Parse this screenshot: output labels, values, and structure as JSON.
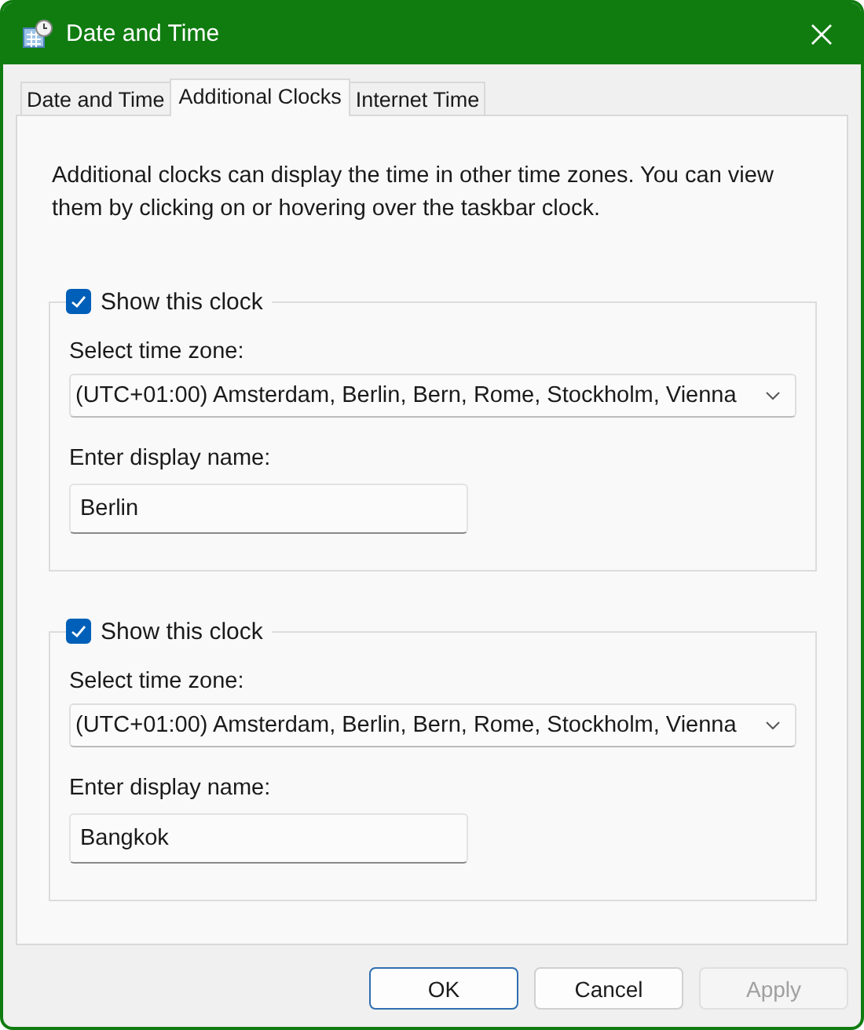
{
  "window": {
    "title": "Date and Time"
  },
  "tabs": [
    {
      "label": "Date and Time",
      "selected": false
    },
    {
      "label": "Additional Clocks",
      "selected": true
    },
    {
      "label": "Internet Time",
      "selected": false
    }
  ],
  "description": "Additional clocks can display the time in other time zones. You can view them by clicking on or hovering over the taskbar clock.",
  "clocks": [
    {
      "show_label": "Show this clock",
      "checked": true,
      "zone_label": "Select time zone:",
      "zone": "(UTC+01:00) Amsterdam, Berlin, Bern, Rome, Stockholm, Vienna",
      "name_label": "Enter display name:",
      "name": "Berlin"
    },
    {
      "show_label": "Show this clock",
      "checked": true,
      "zone_label": "Select time zone:",
      "zone": "(UTC+01:00) Amsterdam, Berlin, Bern, Rome, Stockholm, Vienna",
      "name_label": "Enter display name:",
      "name": "Bangkok"
    }
  ],
  "buttons": [
    {
      "label": "OK",
      "default": true,
      "disabled": false
    },
    {
      "label": "Cancel",
      "default": false,
      "disabled": false
    },
    {
      "label": "Apply",
      "default": false,
      "disabled": true
    }
  ]
}
